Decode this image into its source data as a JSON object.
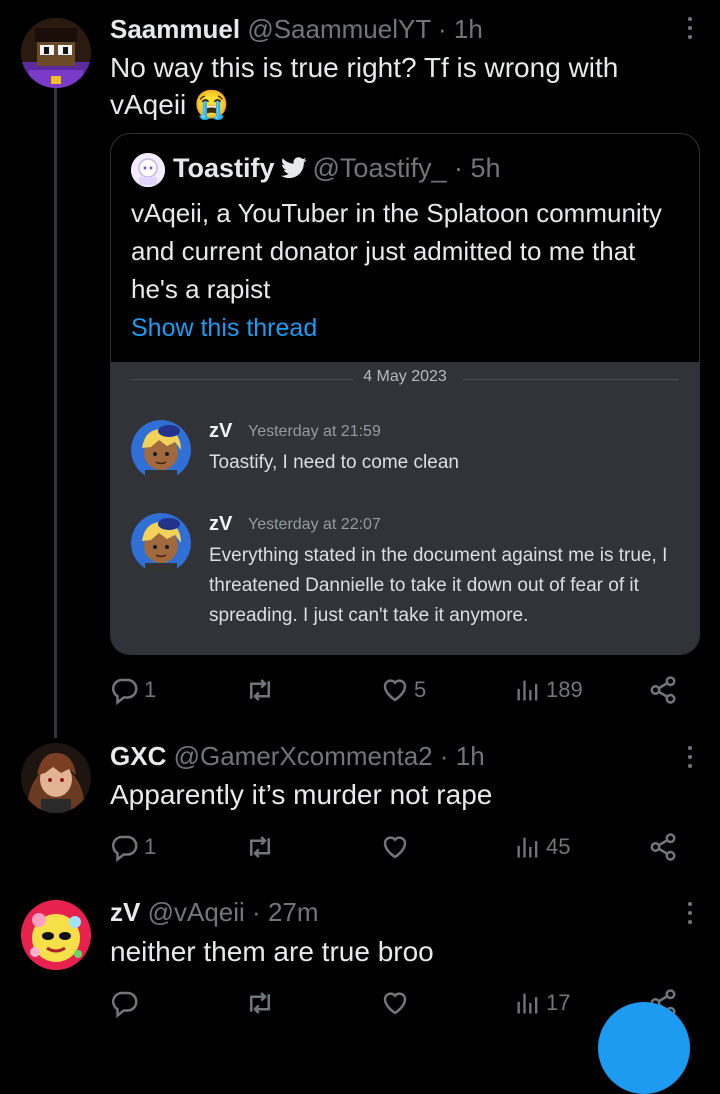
{
  "tweets": [
    {
      "name": "Saammuel",
      "handle": "@SaammuelYT",
      "dot": "·",
      "time": "1h",
      "text": "No way this is true right? Tf is wrong with vAqeii 😭",
      "actions": {
        "reply": "1",
        "retweet": "",
        "like": "5",
        "views": "189"
      }
    },
    {
      "name": "GXC",
      "handle": "@GamerXcommenta2",
      "dot": "·",
      "time": "1h",
      "text": "Apparently it’s murder not rape",
      "actions": {
        "reply": "1",
        "retweet": "",
        "like": "",
        "views": "45"
      }
    },
    {
      "name": "zV",
      "handle": "@vAqeii",
      "dot": "·",
      "time": "27m",
      "text": "neither them are true broo",
      "actions": {
        "reply": "",
        "retweet": "",
        "like": "",
        "views": "17"
      }
    }
  ],
  "quote": {
    "name": "Toastify",
    "handle": "@Toastify_",
    "dot": "·",
    "time": "5h",
    "text": "vAqeii, a YouTuber in the Splatoon community and current donator just admitted to me that he's a rapist",
    "link": "Show this thread",
    "discord": {
      "date": "4 May 2023",
      "messages": [
        {
          "name": "zV",
          "time": "Yesterday at 21:59",
          "text": "Toastify, I need to come clean"
        },
        {
          "name": "zV",
          "time": "Yesterday at 22:07",
          "text": "Everything stated in the document against me is true, I threatened Dannielle to take it down out of fear of it spreading. I just can't take it anymore."
        }
      ]
    }
  },
  "colors": {
    "background": "#000000",
    "accent": "#1d9bf0",
    "muted": "#71767b",
    "discord_bg": "#313338"
  },
  "icons": [
    "reply-icon",
    "retweet-icon",
    "like-icon",
    "views-icon",
    "share-icon",
    "more-icon",
    "verified-bird-icon"
  ]
}
